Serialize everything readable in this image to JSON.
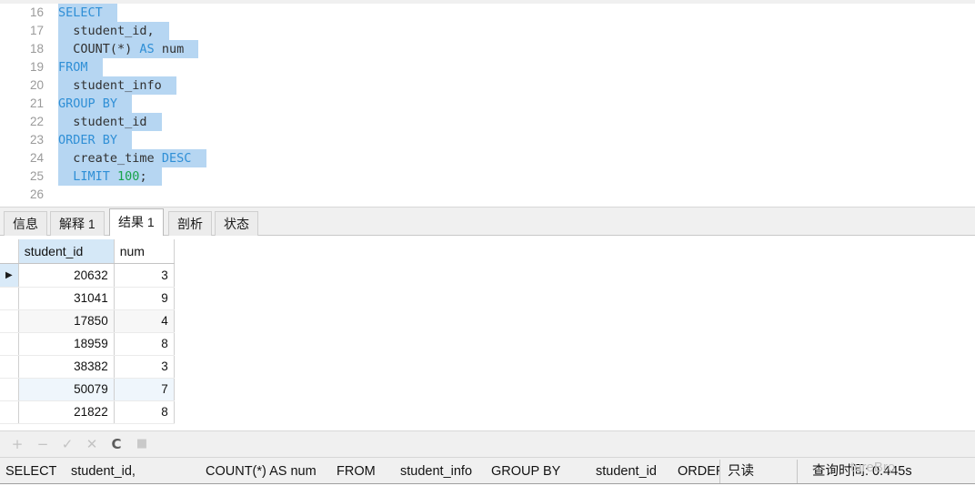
{
  "editor": {
    "first_line_number": 16,
    "lines": [
      {
        "n": 16,
        "tokens": [
          {
            "t": "SELECT",
            "c": "kw"
          }
        ],
        "indent": 0,
        "selected": true,
        "caret": true
      },
      {
        "n": 17,
        "tokens": [
          {
            "t": "student_id,",
            "c": "plain"
          }
        ],
        "indent": 2,
        "selected": true,
        "caret": false
      },
      {
        "n": 18,
        "tokens": [
          {
            "t": "COUNT(*) ",
            "c": "plain"
          },
          {
            "t": "AS",
            "c": "kw"
          },
          {
            "t": " num",
            "c": "plain"
          }
        ],
        "indent": 2,
        "selected": true,
        "caret": false
      },
      {
        "n": 19,
        "tokens": [
          {
            "t": "FROM",
            "c": "kw"
          }
        ],
        "indent": 0,
        "selected": true,
        "caret": false
      },
      {
        "n": 20,
        "tokens": [
          {
            "t": "student_info",
            "c": "plain"
          }
        ],
        "indent": 2,
        "selected": true,
        "caret": false
      },
      {
        "n": 21,
        "tokens": [
          {
            "t": "GROUP BY",
            "c": "kw"
          }
        ],
        "indent": 0,
        "selected": true,
        "caret": false
      },
      {
        "n": 22,
        "tokens": [
          {
            "t": "student_id",
            "c": "plain"
          }
        ],
        "indent": 2,
        "selected": true,
        "caret": false
      },
      {
        "n": 23,
        "tokens": [
          {
            "t": "ORDER BY",
            "c": "kw"
          }
        ],
        "indent": 0,
        "selected": true,
        "caret": false
      },
      {
        "n": 24,
        "tokens": [
          {
            "t": "create_time ",
            "c": "plain"
          },
          {
            "t": "DESC",
            "c": "kw"
          }
        ],
        "indent": 2,
        "selected": true,
        "caret": false
      },
      {
        "n": 25,
        "tokens": [
          {
            "t": "LIMIT ",
            "c": "kw"
          },
          {
            "t": "100",
            "c": "num"
          },
          {
            "t": ";",
            "c": "plain"
          }
        ],
        "indent": 2,
        "selected": true,
        "caret": false
      },
      {
        "n": 26,
        "tokens": [],
        "indent": 0,
        "selected": false,
        "caret": false
      }
    ],
    "colors": {
      "keyword": "#2f8fd6",
      "number": "#18a34a",
      "identifier": "#303030",
      "selection": "#b6d6f2",
      "gutter_text": "#9a9a9a"
    }
  },
  "tabs": [
    {
      "label": "信息",
      "active": false
    },
    {
      "label": "解释 1",
      "active": false
    },
    {
      "label": "结果 1",
      "active": true
    },
    {
      "label": "剖析",
      "active": false
    },
    {
      "label": "状态",
      "active": false
    }
  ],
  "result_grid": {
    "columns": [
      "student_id",
      "num"
    ],
    "selected_column": "student_id",
    "current_row_index": 0,
    "row_indicator_glyph": "▶",
    "rows": [
      {
        "student_id": "20632",
        "num": "3"
      },
      {
        "student_id": "31041",
        "num": "9"
      },
      {
        "student_id": "17850",
        "num": "4"
      },
      {
        "student_id": "18959",
        "num": "8"
      },
      {
        "student_id": "38382",
        "num": "3"
      },
      {
        "student_id": "50079",
        "num": "7"
      },
      {
        "student_id": "21822",
        "num": "8"
      }
    ]
  },
  "nav_toolbar": {
    "buttons": [
      {
        "name": "add-record-button",
        "glyph": "+",
        "style": "plain"
      },
      {
        "name": "delete-record-button",
        "glyph": "−",
        "style": "plain"
      },
      {
        "name": "apply-changes-button",
        "glyph": "✓",
        "style": "plain"
      },
      {
        "name": "cancel-changes-button",
        "glyph": "✕",
        "style": "plain"
      },
      {
        "name": "refresh-button",
        "glyph": "C",
        "style": "strong"
      },
      {
        "name": "stop-button",
        "glyph": "■",
        "style": "sq"
      }
    ]
  },
  "status_bar": {
    "sql_fragments": [
      "SELECT",
      "student_id,",
      "COUNT(*) AS num",
      "FROM",
      "student_info",
      "GROUP BY",
      "student_id",
      "ORDER"
    ],
    "readonly_label": "只读",
    "query_time_label": "查询时间: 0.445s"
  },
  "watermark": {
    "text": "tureBro"
  }
}
